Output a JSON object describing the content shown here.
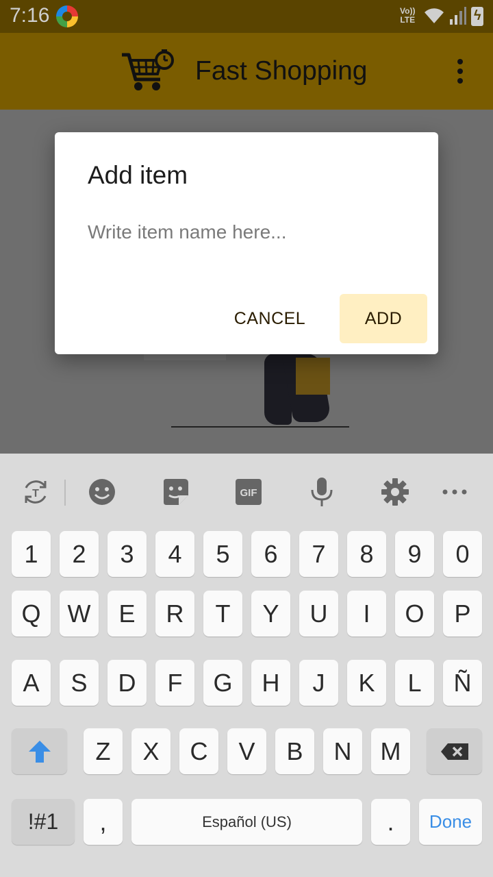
{
  "status_bar": {
    "time": "7:16",
    "network_label": "Vo)) LTE",
    "icons": [
      "browser-icon",
      "wifi-icon",
      "signal-icon",
      "battery-charging-icon"
    ]
  },
  "app_bar": {
    "title": "Fast Shopping",
    "logo_icon": "cart-timer-icon",
    "menu_icon": "more-vert-icon",
    "background": "#7a5c00"
  },
  "dialog": {
    "title": "Add item",
    "input_placeholder": "Write item name here...",
    "input_value": "",
    "cancel_label": "CANCEL",
    "add_label": "ADD",
    "add_button_bg": "#ffefc2"
  },
  "keyboard": {
    "toolbar_icons": [
      "translate-icon",
      "emoji-icon",
      "sticker-icon",
      "gif-icon",
      "microphone-icon",
      "settings-icon",
      "more-horiz-icon"
    ],
    "gif_label": "GIF",
    "rows": [
      [
        "1",
        "2",
        "3",
        "4",
        "5",
        "6",
        "7",
        "8",
        "9",
        "0"
      ],
      [
        "Q",
        "W",
        "E",
        "R",
        "T",
        "Y",
        "U",
        "I",
        "O",
        "P"
      ],
      [
        "A",
        "S",
        "D",
        "F",
        "G",
        "H",
        "J",
        "K",
        "L",
        "Ñ"
      ],
      [
        "Z",
        "X",
        "C",
        "V",
        "B",
        "N",
        "M"
      ]
    ],
    "symbols_label": "!#1",
    "comma_label": ",",
    "space_label": "Español (US)",
    "period_label": ".",
    "done_label": "Done",
    "accent_color": "#3a8ee6"
  }
}
